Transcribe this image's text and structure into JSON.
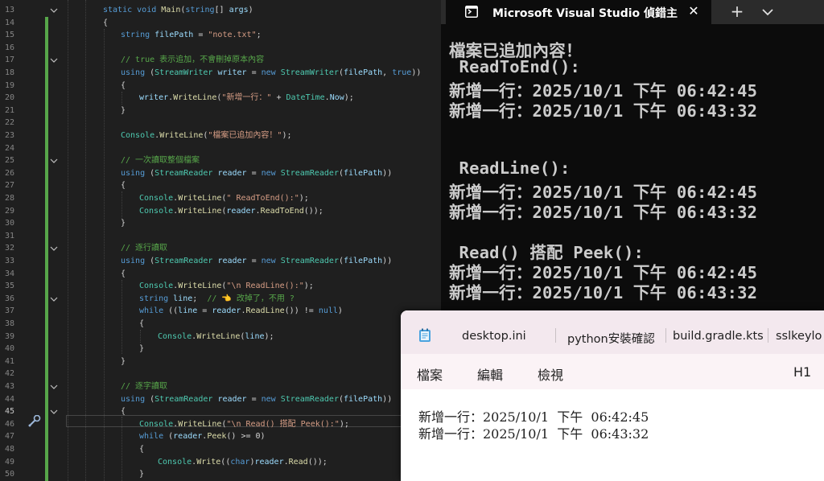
{
  "editor": {
    "lines": [
      {
        "n": "13",
        "code": [
          [
            "kw",
            "static "
          ],
          [
            "kw",
            "void "
          ],
          [
            "mt",
            "Main"
          ],
          [
            "pn",
            "("
          ],
          [
            "kw",
            "string"
          ],
          [
            "pn",
            "[] "
          ],
          [
            "vr",
            "args"
          ],
          [
            "pn",
            ")"
          ]
        ]
      },
      {
        "n": "14",
        "code": [
          [
            "pn",
            "{"
          ]
        ]
      },
      {
        "n": "15",
        "code": [
          [
            "kw",
            "string "
          ],
          [
            "vr",
            "filePath"
          ],
          [
            "pn",
            " = "
          ],
          [
            "str",
            "\"note.txt\""
          ],
          [
            "pn",
            ";"
          ]
        ]
      },
      {
        "n": "16",
        "code": []
      },
      {
        "n": "17",
        "code": [
          [
            "cm",
            "// true 表示追加，不會刪掉原本內容"
          ]
        ]
      },
      {
        "n": "18",
        "code": [
          [
            "kw",
            "using "
          ],
          [
            "pn",
            "("
          ],
          [
            "ty",
            "StreamWriter "
          ],
          [
            "vr",
            "writer"
          ],
          [
            "pn",
            " = "
          ],
          [
            "kw",
            "new "
          ],
          [
            "ty",
            "StreamWriter"
          ],
          [
            "pn",
            "("
          ],
          [
            "vr",
            "filePath"
          ],
          [
            "pn",
            ", "
          ],
          [
            "kw",
            "true"
          ],
          [
            "pn",
            "))"
          ]
        ]
      },
      {
        "n": "19",
        "code": [
          [
            "pn",
            "{"
          ]
        ]
      },
      {
        "n": "20",
        "code": [
          [
            "vr",
            "writer"
          ],
          [
            "pn",
            "."
          ],
          [
            "mt",
            "WriteLine"
          ],
          [
            "pn",
            "("
          ],
          [
            "str",
            "\"新增一行：\""
          ],
          [
            "pn",
            " + "
          ],
          [
            "ty",
            "DateTime"
          ],
          [
            "pn",
            "."
          ],
          [
            "vr",
            "Now"
          ],
          [
            "pn",
            ");"
          ]
        ]
      },
      {
        "n": "21",
        "code": [
          [
            "pn",
            "}"
          ]
        ]
      },
      {
        "n": "22",
        "code": []
      },
      {
        "n": "23",
        "code": [
          [
            "ty",
            "Console"
          ],
          [
            "pn",
            "."
          ],
          [
            "mt",
            "WriteLine"
          ],
          [
            "pn",
            "("
          ],
          [
            "str",
            "\"檔案已追加內容！\""
          ],
          [
            "pn",
            ");"
          ]
        ]
      },
      {
        "n": "24",
        "code": []
      },
      {
        "n": "25",
        "code": [
          [
            "cm",
            "// 一次讀取整個檔案"
          ]
        ]
      },
      {
        "n": "26",
        "code": [
          [
            "kw",
            "using "
          ],
          [
            "pn",
            "("
          ],
          [
            "ty",
            "StreamReader "
          ],
          [
            "vr",
            "reader"
          ],
          [
            "pn",
            " = "
          ],
          [
            "kw",
            "new "
          ],
          [
            "ty",
            "StreamReader"
          ],
          [
            "pn",
            "("
          ],
          [
            "vr",
            "filePath"
          ],
          [
            "pn",
            "))"
          ]
        ]
      },
      {
        "n": "27",
        "code": [
          [
            "pn",
            "{"
          ]
        ]
      },
      {
        "n": "28",
        "code": [
          [
            "ty",
            "Console"
          ],
          [
            "pn",
            "."
          ],
          [
            "mt",
            "WriteLine"
          ],
          [
            "pn",
            "("
          ],
          [
            "str",
            "\" ReadToEnd():\""
          ],
          [
            "pn",
            ");"
          ]
        ]
      },
      {
        "n": "29",
        "code": [
          [
            "ty",
            "Console"
          ],
          [
            "pn",
            "."
          ],
          [
            "mt",
            "WriteLine"
          ],
          [
            "pn",
            "("
          ],
          [
            "vr",
            "reader"
          ],
          [
            "pn",
            "."
          ],
          [
            "mt",
            "ReadToEnd"
          ],
          [
            "pn",
            "());"
          ]
        ]
      },
      {
        "n": "30",
        "code": [
          [
            "pn",
            "}"
          ]
        ]
      },
      {
        "n": "31",
        "code": []
      },
      {
        "n": "32",
        "code": [
          [
            "cm",
            "// 逐行讀取"
          ]
        ]
      },
      {
        "n": "33",
        "code": [
          [
            "kw",
            "using "
          ],
          [
            "pn",
            "("
          ],
          [
            "ty",
            "StreamReader "
          ],
          [
            "vr",
            "reader"
          ],
          [
            "pn",
            " = "
          ],
          [
            "kw",
            "new "
          ],
          [
            "ty",
            "StreamReader"
          ],
          [
            "pn",
            "("
          ],
          [
            "vr",
            "filePath"
          ],
          [
            "pn",
            "))"
          ]
        ]
      },
      {
        "n": "34",
        "code": [
          [
            "pn",
            "{"
          ]
        ]
      },
      {
        "n": "35",
        "code": [
          [
            "ty",
            "Console"
          ],
          [
            "pn",
            "."
          ],
          [
            "mt",
            "WriteLine"
          ],
          [
            "pn",
            "("
          ],
          [
            "str",
            "\"\\n ReadLine():\""
          ],
          [
            "pn",
            ");"
          ]
        ]
      },
      {
        "n": "36",
        "code": [
          [
            "kw",
            "string "
          ],
          [
            "vr",
            "line"
          ],
          [
            "pn",
            ";  "
          ],
          [
            "cm",
            "// 👈 改掉了，不用 ?"
          ]
        ]
      },
      {
        "n": "37",
        "code": [
          [
            "kw",
            "while "
          ],
          [
            "pn",
            "(("
          ],
          [
            "vr",
            "line"
          ],
          [
            "pn",
            " = "
          ],
          [
            "vr",
            "reader"
          ],
          [
            "pn",
            "."
          ],
          [
            "mt",
            "ReadLine"
          ],
          [
            "pn",
            "()) != "
          ],
          [
            "kw",
            "null"
          ],
          [
            "pn",
            ")"
          ]
        ]
      },
      {
        "n": "38",
        "code": [
          [
            "pn",
            "{"
          ]
        ]
      },
      {
        "n": "39",
        "code": [
          [
            "ty",
            "Console"
          ],
          [
            "pn",
            "."
          ],
          [
            "mt",
            "WriteLine"
          ],
          [
            "pn",
            "("
          ],
          [
            "vr",
            "line"
          ],
          [
            "pn",
            ");"
          ]
        ]
      },
      {
        "n": "40",
        "code": [
          [
            "pn",
            "}"
          ]
        ]
      },
      {
        "n": "41",
        "code": [
          [
            "pn",
            "}"
          ]
        ]
      },
      {
        "n": "42",
        "code": []
      },
      {
        "n": "43",
        "code": [
          [
            "cm",
            "// 逐字讀取"
          ]
        ]
      },
      {
        "n": "44",
        "code": [
          [
            "kw",
            "using "
          ],
          [
            "pn",
            "("
          ],
          [
            "ty",
            "StreamReader "
          ],
          [
            "vr",
            "reader"
          ],
          [
            "pn",
            " = "
          ],
          [
            "kw",
            "new "
          ],
          [
            "ty",
            "StreamReader"
          ],
          [
            "pn",
            "("
          ],
          [
            "vr",
            "filePath"
          ],
          [
            "pn",
            "))"
          ]
        ]
      },
      {
        "n": "45",
        "code": [
          [
            "pn",
            "{"
          ]
        ]
      },
      {
        "n": "46",
        "code": [
          [
            "ty",
            "Console"
          ],
          [
            "pn",
            "."
          ],
          [
            "mt",
            "WriteLine"
          ],
          [
            "pn",
            "("
          ],
          [
            "str",
            "\"\\n Read() 搭配 Peek():\""
          ],
          [
            "pn",
            ");"
          ]
        ]
      },
      {
        "n": "47",
        "code": [
          [
            "kw",
            "while "
          ],
          [
            "pn",
            "("
          ],
          [
            "vr",
            "reader"
          ],
          [
            "pn",
            "."
          ],
          [
            "mt",
            "Peek"
          ],
          [
            "pn",
            "() >= 0)"
          ]
        ]
      },
      {
        "n": "48",
        "code": [
          [
            "pn",
            "{"
          ]
        ]
      },
      {
        "n": "49",
        "code": [
          [
            "ty",
            "Console"
          ],
          [
            "pn",
            "."
          ],
          [
            "mt",
            "Write"
          ],
          [
            "pn",
            "(("
          ],
          [
            "kw",
            "char"
          ],
          [
            "pn",
            ")"
          ],
          [
            "vr",
            "reader"
          ],
          [
            "pn",
            "."
          ],
          [
            "mt",
            "Read"
          ],
          [
            "pn",
            "());"
          ]
        ]
      },
      {
        "n": "50",
        "code": [
          [
            "pn",
            "}"
          ]
        ]
      }
    ],
    "current_line": "45"
  },
  "console": {
    "tab_title": "Microsoft Visual Studio 偵錯主",
    "close_glyph": "✕",
    "new_tab_glyph": "+",
    "output": [
      "檔案已追加內容！",
      " ReadToEnd():",
      "新增一行：2025/10/1 下午 06:42:45",
      "新增一行：2025/10/1 下午 06:43:32",
      "",
      "",
      " ReadLine():",
      "新增一行：2025/10/1 下午 06:42:45",
      "新增一行：2025/10/1 下午 06:43:32",
      "",
      " Read() 搭配 Peek():",
      "新增一行：2025/10/1 下午 06:42:45",
      "新增一行：2025/10/1 下午 06:43:32"
    ]
  },
  "notepad": {
    "tabs": [
      "desktop.ini",
      "python安裝確認",
      "build.gradle.kts",
      "sslkeylo"
    ],
    "menu": [
      "檔案",
      "編輯",
      "檢視"
    ],
    "heading_control": "H1",
    "content": [
      "新增一行：2025/10/1  下午  06:42:45",
      "新增一行：2025/10/1  下午  06:43:32"
    ]
  },
  "colors": {
    "editor_bg": "#1f1f1f",
    "console_bg": "#0c0c0c",
    "keyword": "#569cd6",
    "type": "#4ec9b0",
    "string": "#d69d85",
    "comment": "#57a64a",
    "method": "#dcdcaa",
    "variable": "#9cdcfe",
    "notepad_tabbar": "#f3e8ee"
  }
}
